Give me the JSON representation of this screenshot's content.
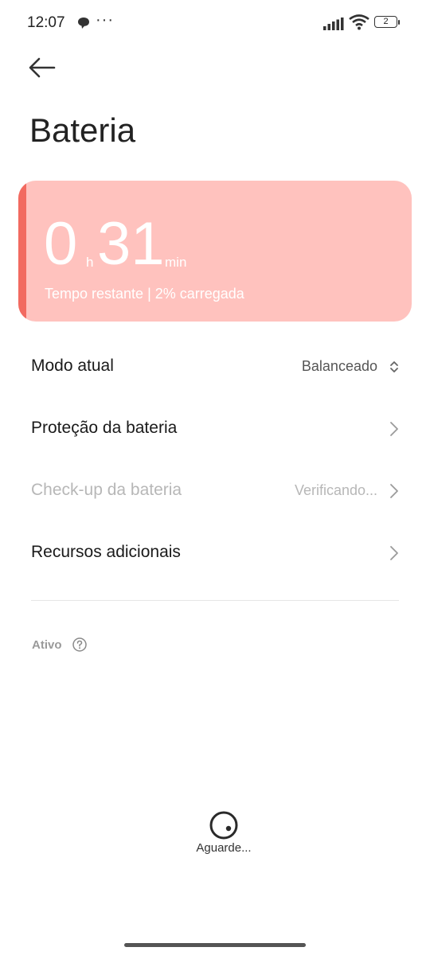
{
  "status_bar": {
    "time": "12:07",
    "more": "···",
    "battery_level": "2"
  },
  "header": {
    "title": "Bateria"
  },
  "battery_card": {
    "hours": "0",
    "hours_unit": "h",
    "minutes": "31",
    "minutes_unit": "min",
    "remaining_text": "Tempo restante | 2% carregada",
    "card_color": "#ffc2be",
    "accent_color": "#f26a60"
  },
  "settings": {
    "mode_label": "Modo atual",
    "mode_value": "Balanceado",
    "protection_label": "Proteção da bateria",
    "checkup_label": "Check-up da bateria",
    "checkup_value": "Verificando...",
    "resources_label": "Recursos adicionais"
  },
  "section": {
    "active_label": "Ativo"
  },
  "loading": {
    "text": "Aguarde..."
  }
}
